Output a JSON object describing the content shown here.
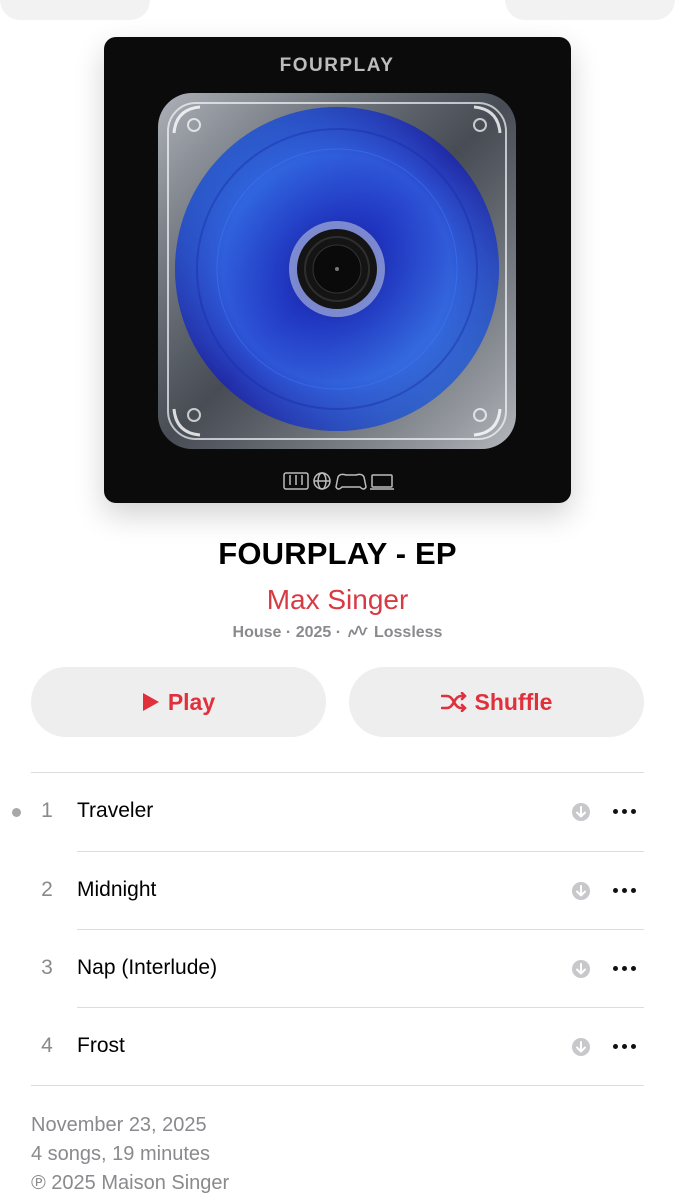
{
  "album": {
    "art_text": "FOURPLAY",
    "title": "FOURPLAY - EP",
    "artist": "Max Singer",
    "genre": "House",
    "year": "2025",
    "quality": "Lossless"
  },
  "buttons": {
    "play_label": "Play",
    "shuffle_label": "Shuffle"
  },
  "tracks": [
    {
      "number": "1",
      "title": "Traveler"
    },
    {
      "number": "2",
      "title": "Midnight"
    },
    {
      "number": "3",
      "title": "Nap (Interlude)"
    },
    {
      "number": "4",
      "title": "Frost"
    }
  ],
  "footer": {
    "release_date": "November 23, 2025",
    "summary": "4 songs, 19 minutes",
    "copyright": "℗ 2025 Maison Singer"
  },
  "colors": {
    "accent": "#e0303c",
    "secondary_text": "#8a8a8e"
  }
}
